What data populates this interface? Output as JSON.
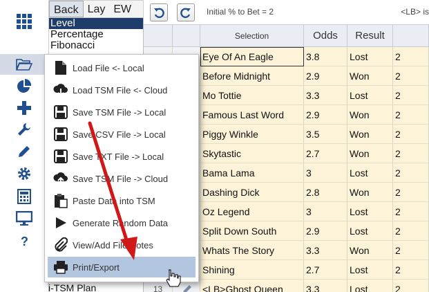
{
  "staking": {
    "tabs": [
      "Back",
      "Lay",
      "EW"
    ],
    "items": [
      "Level",
      "Percentage",
      "Fibonacci"
    ],
    "selected_item": "Level",
    "footer_item": "i-TSM Plan"
  },
  "toolbar": {
    "status": "Initial % to Bet = 2",
    "lb_text": "<LB> is"
  },
  "grid": {
    "headers": {
      "selection": "Selection",
      "odds": "Odds",
      "result": "Result"
    },
    "rows": [
      {
        "selection": "Eye Of An Eagle",
        "odds": "3.8",
        "result": "Lost",
        "extra": "2"
      },
      {
        "selection": "Before Midnight",
        "odds": "2.9",
        "result": "Won",
        "extra": "2"
      },
      {
        "selection": "Mo Tottie",
        "odds": "3.3",
        "result": "Lost",
        "extra": "2"
      },
      {
        "selection": "Famous Last Word",
        "odds": "2.9",
        "result": "Won",
        "extra": "2"
      },
      {
        "selection": "Piggy Winkle",
        "odds": "3.5",
        "result": "Won",
        "extra": "2"
      },
      {
        "selection": "Skytastic",
        "odds": "2.7",
        "result": "Won",
        "extra": "2"
      },
      {
        "selection": "Bama Lama",
        "odds": "3",
        "result": "Lost",
        "extra": "2"
      },
      {
        "selection": "Dashing Dick",
        "odds": "2.8",
        "result": "Won",
        "extra": "2"
      },
      {
        "selection": "Oz Legend",
        "odds": "3",
        "result": "Lost",
        "extra": "2"
      },
      {
        "selection": "Split Down South",
        "odds": "2.9",
        "result": "Lost",
        "extra": "2"
      },
      {
        "selection": "Whats The Story",
        "odds": "3.3",
        "result": "Won",
        "extra": "2"
      },
      {
        "selection": "Shining",
        "odds": "2.7",
        "result": "Lost",
        "extra": "2"
      },
      {
        "selection": "<LB>Ghost Queen",
        "odds": "3.3",
        "result": "Lost",
        "extra": "2"
      }
    ],
    "last_row_index": "13"
  },
  "menu": {
    "items": [
      {
        "label": "Load File <- Local",
        "icon": "file-icon"
      },
      {
        "label": "Load TSM File <- Cloud",
        "icon": "cloud-download-icon"
      },
      {
        "label": "Save TSM File -> Local",
        "icon": "floppy-icon"
      },
      {
        "label": "Save CSV File -> Local",
        "icon": "floppy-icon"
      },
      {
        "label": "Save TXT File -> Local",
        "icon": "floppy-icon"
      },
      {
        "label": "Save TSM File -> Cloud",
        "icon": "cloud-upload-icon"
      },
      {
        "label": "Paste Data into TSM",
        "icon": "paste-icon"
      },
      {
        "label": "Generate Random Data",
        "icon": "play-icon"
      },
      {
        "label": "View/Add File Notes",
        "icon": "paperclip-icon"
      },
      {
        "label": "Print/Export",
        "icon": "printer-icon"
      }
    ],
    "hovered": "Print/Export"
  },
  "colors": {
    "sidebar_icon": "#1f4f8f",
    "menu_icon": "#222222",
    "menu_hover": "#b3c6e0",
    "row_bg": "#fcf3d8",
    "arrow": "#d11818"
  }
}
